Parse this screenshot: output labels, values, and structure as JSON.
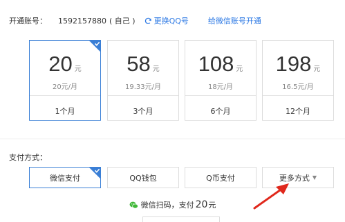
{
  "account": {
    "label": "开通账号：",
    "number": "1592157880",
    "tag": "( 自己 )",
    "change_link": "更换QQ号",
    "wechat_link": "给微信账号开通"
  },
  "plans": [
    {
      "price": "20",
      "unit": "元",
      "monthly": "20元/月",
      "duration": "1个月",
      "selected": true
    },
    {
      "price": "58",
      "unit": "元",
      "monthly": "19.33元/月",
      "duration": "3个月",
      "selected": false
    },
    {
      "price": "108",
      "unit": "元",
      "monthly": "18元/月",
      "duration": "6个月",
      "selected": false
    },
    {
      "price": "198",
      "unit": "元",
      "monthly": "16.5元/月",
      "duration": "12个月",
      "selected": false
    }
  ],
  "payment": {
    "label": "支付方式：",
    "methods": [
      {
        "label": "微信支付",
        "selected": true
      },
      {
        "label": "QQ钱包",
        "selected": false
      },
      {
        "label": "Q币支付",
        "selected": false
      },
      {
        "label": "更多方式",
        "selected": false,
        "dropdown": true
      }
    ]
  },
  "scan": {
    "text_prefix": "微信扫码，支付",
    "amount": "20",
    "unit": "元"
  },
  "colors": {
    "accent": "#3a7fd6",
    "link": "#2b78e4",
    "annotation_arrow": "#e0281c",
    "wechat_green": "#3fb838"
  },
  "icons": {
    "refresh": "refresh-icon",
    "check": "check-icon",
    "wechat": "wechat-icon",
    "dropdown": "triangle-down-icon"
  }
}
